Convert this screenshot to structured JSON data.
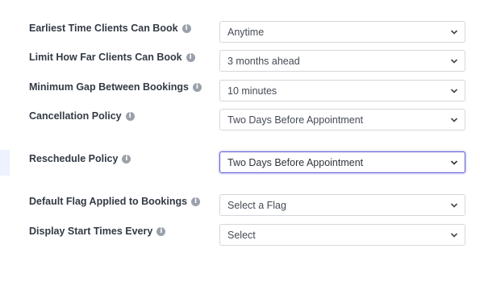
{
  "settings": [
    {
      "label": "Earliest Time Clients Can Book",
      "value": "Anytime"
    },
    {
      "label": "Limit How Far Clients Can Book",
      "value": "3 months ahead"
    },
    {
      "label": "Minimum Gap Between Bookings",
      "value": "10 minutes"
    },
    {
      "label": "Cancellation Policy",
      "value": "Two Days Before Appointment"
    },
    {
      "label": "Reschedule Policy",
      "value": "Two Days Before Appointment",
      "focused": true
    },
    {
      "label": "Default Flag Applied to Bookings",
      "value": "Select a Flag"
    },
    {
      "label": "Display Start Times Every",
      "value": "Select"
    }
  ],
  "icons": {
    "info": "info-icon",
    "dropdown": "chevron-down-icon"
  },
  "info_glyph": "i",
  "colors": {
    "label_text": "#333a44",
    "focus_border": "#5b57d4",
    "input_border": "#d3d7dd",
    "info_icon": "#9aa1aa"
  }
}
